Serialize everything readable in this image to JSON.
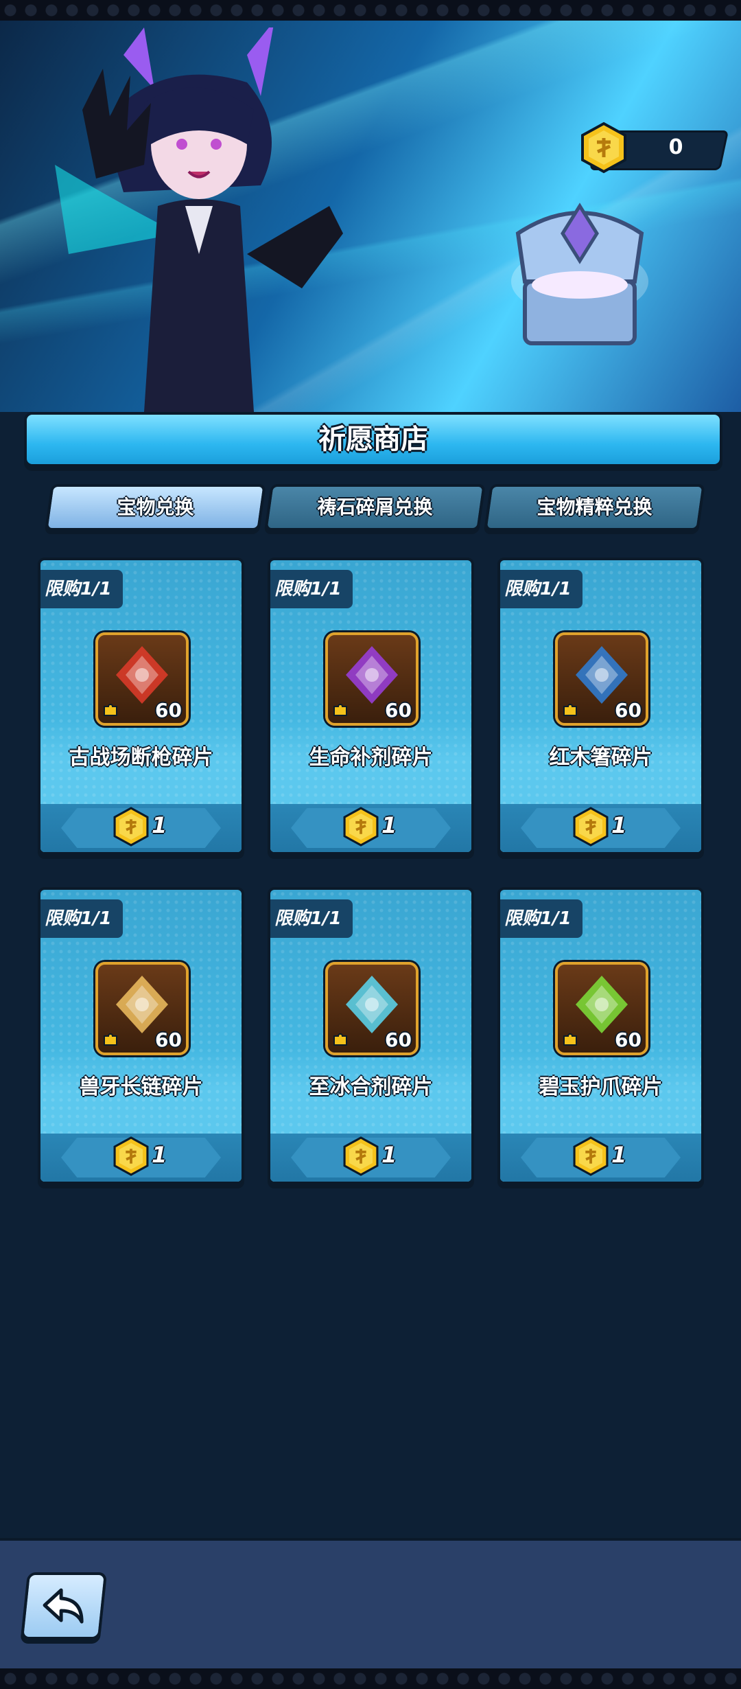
{
  "header": {
    "currency_amount": "0",
    "currency_icon": "gold-coin-icon"
  },
  "title": "祈愿商店",
  "tabs": [
    {
      "label": "宝物兑换",
      "active": true
    },
    {
      "label": "祷石碎屑兑换",
      "active": false
    },
    {
      "label": "宝物精粹兑换",
      "active": false
    }
  ],
  "items": [
    {
      "limit": "限购1/1",
      "name": "古战场断枪碎片",
      "count": "60",
      "price": "1",
      "icon": "broken-spear-icon",
      "color": "#e03b2a"
    },
    {
      "limit": "限购1/1",
      "name": "生命补剂碎片",
      "count": "60",
      "price": "1",
      "icon": "potion-icon",
      "color": "#9b3ee0"
    },
    {
      "limit": "限购1/1",
      "name": "红木箸碎片",
      "count": "60",
      "price": "1",
      "icon": "chopsticks-icon",
      "color": "#2e7fd8"
    },
    {
      "limit": "限购1/1",
      "name": "兽牙长链碎片",
      "count": "60",
      "price": "1",
      "icon": "fang-chain-icon",
      "color": "#f0c060"
    },
    {
      "limit": "限购1/1",
      "name": "至冰合剂碎片",
      "count": "60",
      "price": "1",
      "icon": "ice-flask-icon",
      "color": "#5ad8f2"
    },
    {
      "limit": "限购1/1",
      "name": "碧玉护爪碎片",
      "count": "60",
      "price": "1",
      "icon": "jade-claw-icon",
      "color": "#7ee03a"
    }
  ],
  "footer": {
    "back_icon": "back-arrow-icon"
  }
}
